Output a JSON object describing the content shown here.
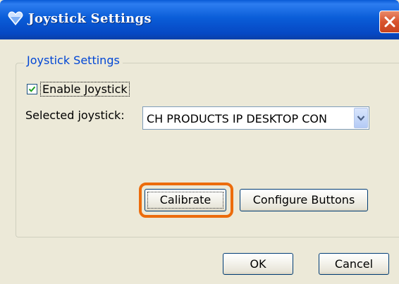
{
  "window": {
    "title": "Joystick Settings"
  },
  "group": {
    "legend": "Joystick Settings"
  },
  "enable_joystick": {
    "label": "Enable Joystick",
    "checked": true
  },
  "selected_joystick": {
    "label": "Selected joystick:",
    "value": "CH PRODUCTS IP DESKTOP CON"
  },
  "buttons": {
    "calibrate": "Calibrate",
    "configure": "Configure Buttons",
    "ok": "OK",
    "cancel": "Cancel"
  },
  "icons": {
    "title": "heart-gem-icon",
    "close": "close-icon",
    "dropdown": "chevron-down-icon",
    "check": "check-icon"
  },
  "colors": {
    "titlebar": "#0a5dd8",
    "legend_text": "#0046d5",
    "highlight": "#ec6c0c",
    "close_button": "#d8542e"
  }
}
